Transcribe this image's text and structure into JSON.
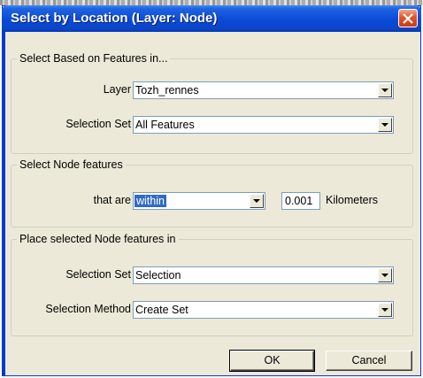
{
  "window": {
    "title": "Select by Location (Layer: Node)"
  },
  "group_features": {
    "legend": "Select Based on Features in...",
    "layer_label": "Layer",
    "layer_value": "Tozh_rennes",
    "selection_set_label": "Selection Set",
    "selection_set_value": "All Features"
  },
  "group_node": {
    "legend": "Select Node features",
    "that_are_label": "that are",
    "relation_value": "within",
    "distance_value": "0.001",
    "unit_label": "Kilometers"
  },
  "group_place": {
    "legend": "Place selected Node features in",
    "selection_set_label": "Selection Set",
    "selection_set_value": "Selection",
    "method_label": "Selection Method",
    "method_value": "Create Set"
  },
  "buttons": {
    "ok": "OK",
    "cancel": "Cancel"
  },
  "colors": {
    "titlebar": "#0a4ad6",
    "close": "#e0542b",
    "face": "#ece9d8",
    "highlight": "#316ac5"
  },
  "icons": {
    "close": "close-icon",
    "dropdown": "chevron-down-icon"
  }
}
